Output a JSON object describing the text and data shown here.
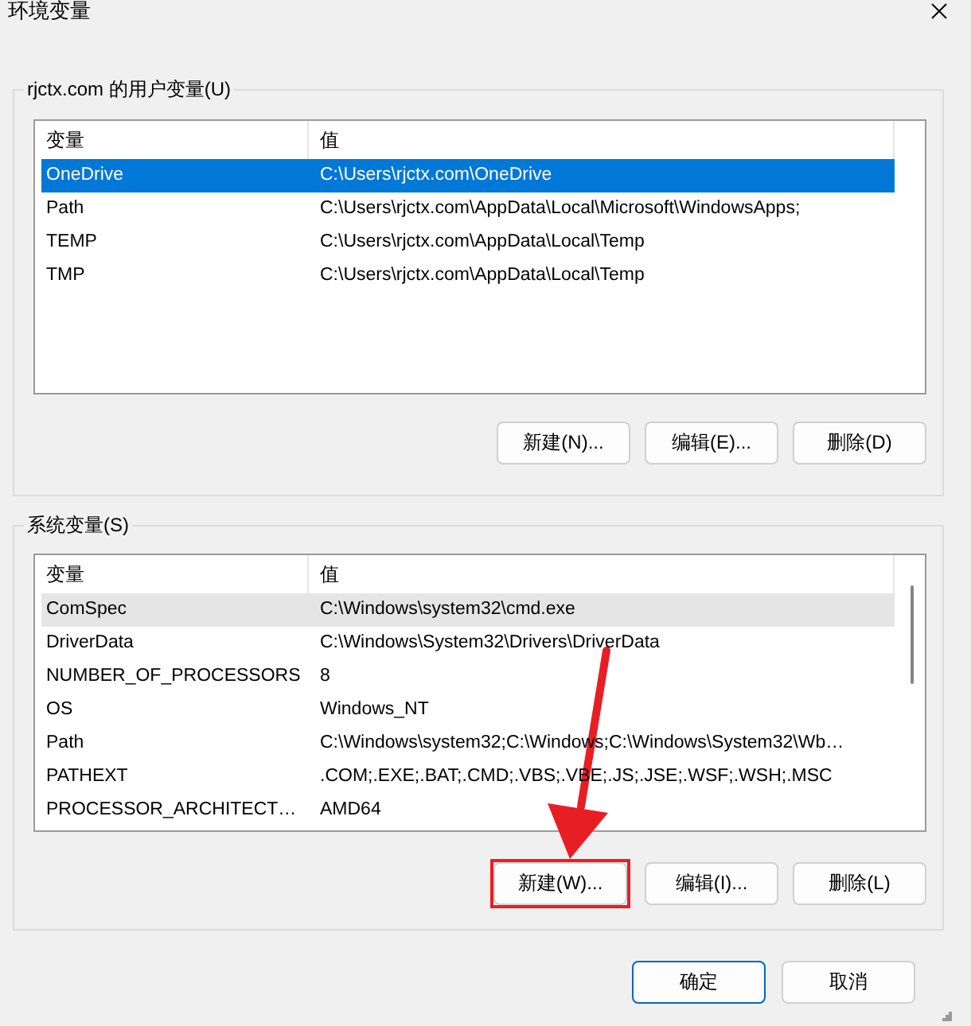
{
  "window": {
    "title": "环境变量"
  },
  "user_variables": {
    "label": "rjctx.com 的用户变量(U)",
    "focused": true,
    "scrollable": false,
    "columns": [
      "变量",
      "值"
    ],
    "rows": [
      {
        "name": "OneDrive",
        "value": "C:\\Users\\rjctx.com\\OneDrive",
        "selected": true
      },
      {
        "name": "Path",
        "value": "C:\\Users\\rjctx.com\\AppData\\Local\\Microsoft\\WindowsApps;",
        "selected": false
      },
      {
        "name": "TEMP",
        "value": "C:\\Users\\rjctx.com\\AppData\\Local\\Temp",
        "selected": false
      },
      {
        "name": "TMP",
        "value": "C:\\Users\\rjctx.com\\AppData\\Local\\Temp",
        "selected": false
      }
    ],
    "buttons": [
      {
        "label": "新建(N)...",
        "highlighted": false
      },
      {
        "label": "编辑(E)...",
        "highlighted": false
      },
      {
        "label": "删除(D)",
        "highlighted": false
      }
    ]
  },
  "system_variables": {
    "label": "系统变量(S)",
    "focused": false,
    "scrollable": true,
    "columns": [
      "变量",
      "值"
    ],
    "rows": [
      {
        "name": "ComSpec",
        "value": "C:\\Windows\\system32\\cmd.exe",
        "selected": true
      },
      {
        "name": "DriverData",
        "value": "C:\\Windows\\System32\\Drivers\\DriverData",
        "selected": false
      },
      {
        "name": "NUMBER_OF_PROCESSORS",
        "value": "8",
        "selected": false
      },
      {
        "name": "OS",
        "value": "Windows_NT",
        "selected": false
      },
      {
        "name": "Path",
        "value": "C:\\Windows\\system32;C:\\Windows;C:\\Windows\\System32\\Wb…",
        "selected": false
      },
      {
        "name": "PATHEXT",
        "value": ".COM;.EXE;.BAT;.CMD;.VBS;.VBE;.JS;.JSE;.WSF;.WSH;.MSC",
        "selected": false
      },
      {
        "name": "PROCESSOR_ARCHITECT…",
        "value": "AMD64",
        "selected": false
      }
    ],
    "buttons": [
      {
        "label": "新建(W)...",
        "highlighted": true
      },
      {
        "label": "编辑(I)...",
        "highlighted": false
      },
      {
        "label": "删除(L)",
        "highlighted": false
      }
    ]
  },
  "dialog_buttons": [
    {
      "label": "确定",
      "default": true
    },
    {
      "label": "取消",
      "default": false
    }
  ]
}
